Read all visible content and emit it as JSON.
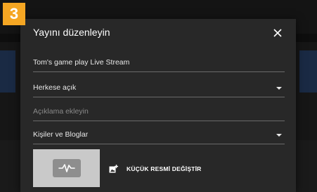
{
  "step_badge": "3",
  "dialog": {
    "title": "Yayını düzenleyin",
    "fields": {
      "title_value": "Tom's game play Live Stream",
      "privacy_value": "Herkese açık",
      "description_placeholder": "Açıklama ekleyin",
      "category_value": "Kişiler ve Bloglar"
    },
    "thumbnail": {
      "change_label": "KÜÇÜK RESMİ DEĞİŞTİR"
    }
  },
  "icons": {
    "close": "close-icon",
    "dropdown": "arrow-drop-down-icon",
    "add_photo": "add-photo-icon",
    "thumbnail_placeholder": "live-pulse-icon"
  },
  "colors": {
    "badge": "#f5a623",
    "dialog_bg": "#282828",
    "page_bg": "#0e0e0e"
  }
}
